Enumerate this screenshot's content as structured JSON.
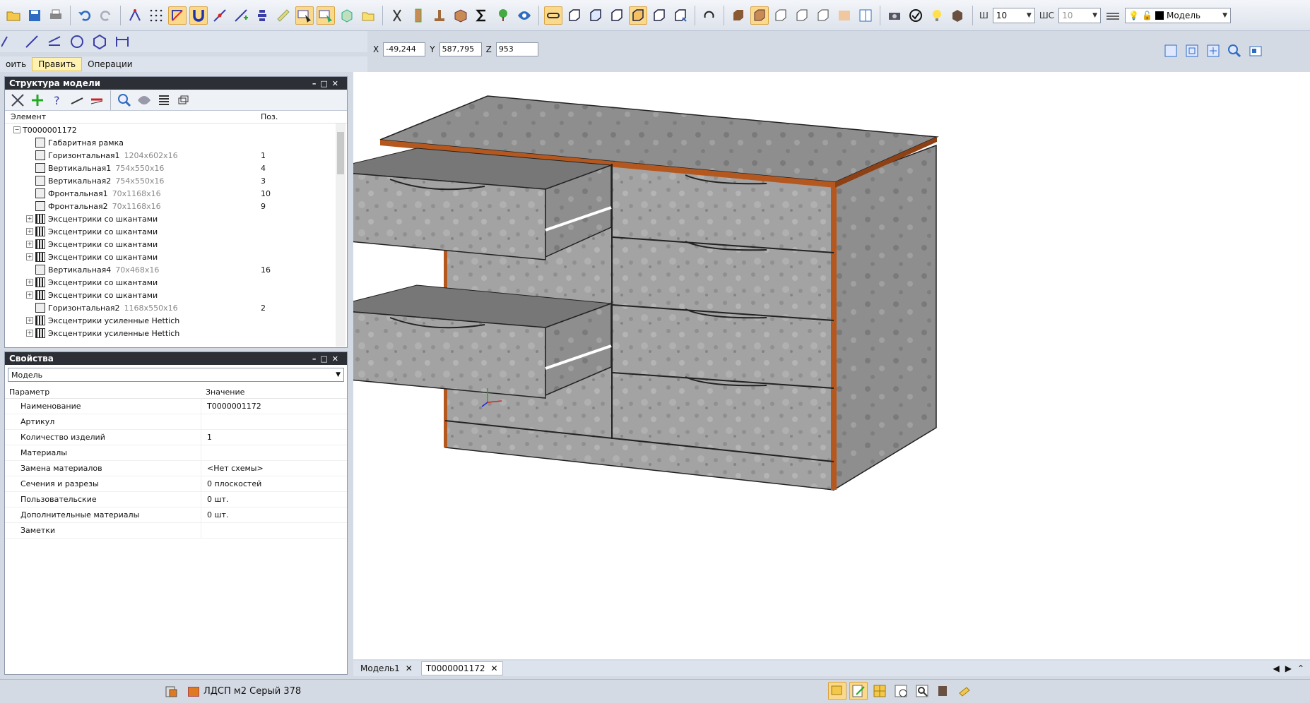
{
  "toolbar": {
    "left_icons": [
      "folder-open-icon",
      "save-icon",
      "print-icon",
      "undo-icon",
      "redo-icon",
      "node-icon",
      "grid-icon",
      "snap-icon",
      "magnet-icon",
      "line-snap-icon",
      "point-snap-icon",
      "align-icon",
      "measure-icon",
      "select-icon",
      "select-plus-icon",
      "copy-icon",
      "folder-icon",
      "cut-icon",
      "panel-icon",
      "stand-icon",
      "box-icon",
      "sum-icon",
      "tree-icon",
      "eye-icon",
      "link-icon",
      "view-cube-1-icon",
      "view-cube-2-icon",
      "view-cube-3-icon",
      "view-cube-4-icon",
      "view-cube-5-icon",
      "view-cube-6-icon",
      "rotate-icon",
      "texture-icon",
      "solid-cube-icon",
      "wire-cube-1-icon",
      "wire-cube-2-icon",
      "wire-cube-3-icon",
      "shaded-icon",
      "split-view-icon",
      "camera-icon",
      "check-circle-icon",
      "bulb-icon",
      "box-dropdown-icon"
    ],
    "w_label": "Ш",
    "w_value": "10",
    "ws_label": "ШС",
    "ws_value": "10",
    "layer_value": "Модель",
    "layer_color": "#000000"
  },
  "tabs": [
    {
      "label": "оить"
    },
    {
      "label": "Править",
      "active": true
    },
    {
      "label": "Операции"
    }
  ],
  "coords": {
    "x_label": "X",
    "x_value": "-49,244",
    "y_label": "Y",
    "y_value": "587,795",
    "z_label": "Z",
    "z_value": "953"
  },
  "structure": {
    "title": "Структура модели",
    "col_element": "Элемент",
    "col_pos": "Поз.",
    "root": "T0000001172",
    "items": [
      {
        "name": "Габаритная рамка",
        "dim": "",
        "pos": "",
        "type": "frame",
        "expandable": false
      },
      {
        "name": "Горизонтальная1",
        "dim": "1204x602x16",
        "pos": "1",
        "type": "panel",
        "expandable": false
      },
      {
        "name": "Вертикальная1",
        "dim": "754x550x16",
        "pos": "4",
        "type": "panel",
        "expandable": false
      },
      {
        "name": "Вертикальная2",
        "dim": "754x550x16",
        "pos": "3",
        "type": "panel",
        "expandable": false
      },
      {
        "name": "Фронтальная1",
        "dim": "70x1168x16",
        "pos": "10",
        "type": "panel",
        "expandable": false
      },
      {
        "name": "Фронтальная2",
        "dim": "70x1168x16",
        "pos": "9",
        "type": "panel",
        "expandable": false
      },
      {
        "name": "Эксцентрики со шкантами",
        "dim": "",
        "pos": "",
        "type": "group",
        "expandable": true
      },
      {
        "name": "Эксцентрики со шкантами",
        "dim": "",
        "pos": "",
        "type": "group",
        "expandable": true
      },
      {
        "name": "Эксцентрики со шкантами",
        "dim": "",
        "pos": "",
        "type": "group",
        "expandable": true
      },
      {
        "name": "Эксцентрики со шкантами",
        "dim": "",
        "pos": "",
        "type": "group",
        "expandable": true
      },
      {
        "name": "Вертикальная4",
        "dim": "70x468x16",
        "pos": "16",
        "type": "panel",
        "expandable": false
      },
      {
        "name": "Эксцентрики со шкантами",
        "dim": "",
        "pos": "",
        "type": "group",
        "expandable": true
      },
      {
        "name": "Эксцентрики со шкантами",
        "dim": "",
        "pos": "",
        "type": "group",
        "expandable": true
      },
      {
        "name": "Горизонтальная2",
        "dim": "1168x550x16",
        "pos": "2",
        "type": "panel",
        "expandable": false
      },
      {
        "name": "Эксцентрики усиленные Hettich",
        "dim": "",
        "pos": "",
        "type": "group",
        "expandable": true
      },
      {
        "name": "Эксцентрики усиленные Hettich",
        "dim": "",
        "pos": "",
        "type": "group",
        "expandable": true
      }
    ]
  },
  "properties": {
    "title": "Свойства",
    "selector": "Модель",
    "col_param": "Параметр",
    "col_value": "Значение",
    "rows": [
      {
        "key": "Наименование",
        "value": "T0000001172"
      },
      {
        "key": "Артикул",
        "value": ""
      },
      {
        "key": "Количество изделий",
        "value": "1"
      },
      {
        "key": "Материалы",
        "value": ""
      },
      {
        "key": "Замена материалов",
        "value": "<Нет схемы>"
      },
      {
        "key": "Сечения и разрезы",
        "value": "0 плоскостей"
      },
      {
        "key": "Пользовательские",
        "value": "0 шт."
      },
      {
        "key": "Дополнительные материалы",
        "value": "0 шт."
      },
      {
        "key": "Заметки",
        "value": ""
      }
    ]
  },
  "document_tabs": [
    {
      "label": "Модель1",
      "active": false
    },
    {
      "label": "T0000001172",
      "active": true
    }
  ],
  "status": {
    "material": "ЛДСП м2 Серый 378",
    "material_color": "#e07a20"
  },
  "colors": {
    "edge": "#b5581f",
    "concrete": "#9c9c9c"
  }
}
